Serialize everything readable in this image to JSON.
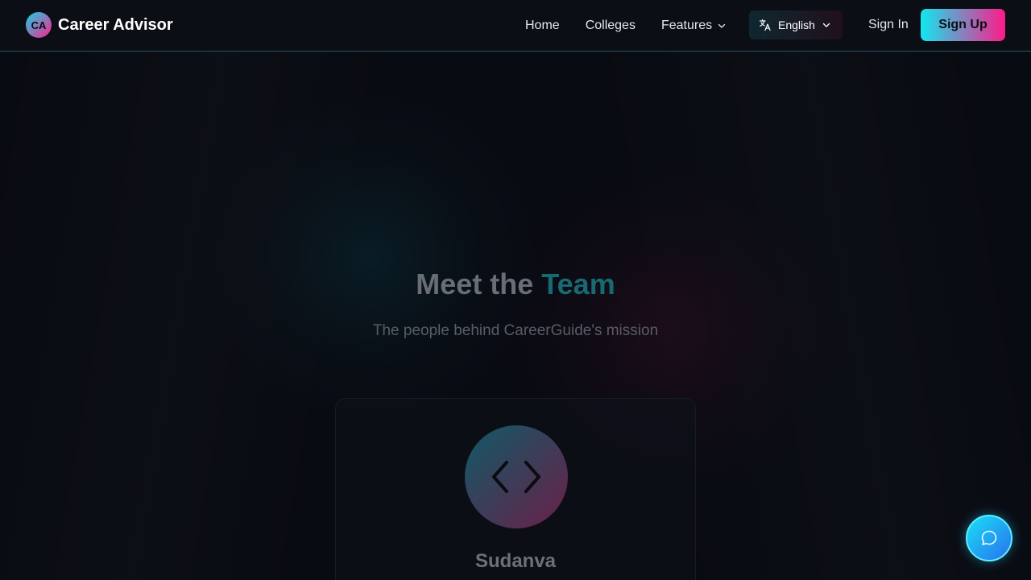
{
  "brand": {
    "logo_text": "CA",
    "name": "Career Advisor"
  },
  "nav": {
    "home": "Home",
    "colleges": "Colleges",
    "features": "Features"
  },
  "language": {
    "selected": "English"
  },
  "auth": {
    "sign_in": "Sign In",
    "sign_up": "Sign Up"
  },
  "hero": {
    "title_prefix": "Meet the",
    "title_accent": "Team",
    "subtitle": "The people behind CareerGuide's mission"
  },
  "team": [
    {
      "name": "Sudanva",
      "icon": "code-icon"
    }
  ],
  "icons": {
    "language": "translate-icon",
    "dropdown": "chevron-down-icon",
    "chat": "chat-bubble-icon"
  },
  "colors": {
    "accent_cyan": "#12d6e6",
    "accent_pink": "#ff1f8e",
    "background": "#090b12"
  }
}
